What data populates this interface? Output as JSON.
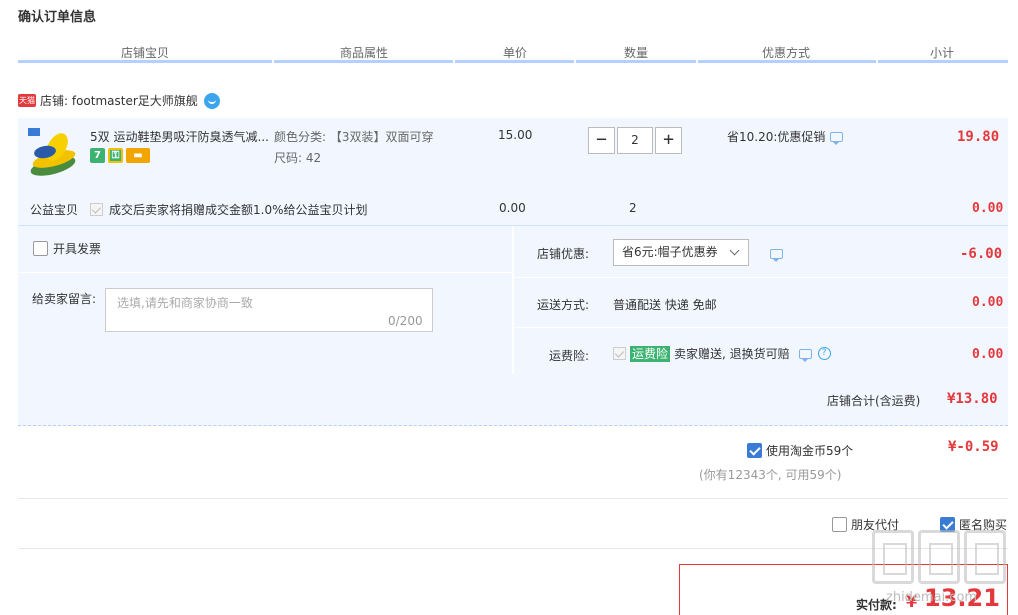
{
  "page_title": "确认订单信息",
  "columns": [
    "店铺宝贝",
    "商品属性",
    "单价",
    "数量",
    "优惠方式",
    "小计"
  ],
  "shop": {
    "badge": "天猫",
    "label": "店铺: footmaster足大师旗舰"
  },
  "item": {
    "title": "5双 运动鞋垫男吸汗防臭透气减...",
    "badge_7": "7",
    "attr_color": "颜色分类: 【3双装】双面可穿",
    "attr_size": "尺码: 42",
    "price": "15.00",
    "quantity": "2",
    "minus": "−",
    "plus": "+",
    "promo": "省10.20:优惠促销",
    "subtotal": "19.80"
  },
  "charity": {
    "label": "公益宝贝",
    "text": "成交后卖家将捐赠成交金额1.0%给公益宝贝计划",
    "price": "0.00",
    "quantity": "2",
    "subtotal": "0.00"
  },
  "invoice_label": "开具发票",
  "message": {
    "label": "给卖家留言:",
    "placeholder": "选填,请先和商家协商一致",
    "count": "0/200"
  },
  "shop_discount": {
    "label": "店铺优惠:",
    "value": "省6元:帽子优惠券",
    "amount": "-6.00"
  },
  "shipping": {
    "label": "运送方式:",
    "value": "普通配送 快递 免邮",
    "amount": "0.00"
  },
  "insurance": {
    "label": "运费险:",
    "badge": "运费险",
    "text": "卖家赠送, 退换货可赔",
    "amount": "0.00"
  },
  "store_total": {
    "label": "店铺合计(含运费)",
    "amount": "¥13.80"
  },
  "taobao_coin": {
    "label": "使用淘金币59个",
    "amount": "¥-0.59",
    "note": "(你有12343个, 可用59个)"
  },
  "options": {
    "friend_pay": "朋友代付",
    "anonymous": "匿名购买"
  },
  "final": {
    "label": "实付款:",
    "currency": "¥",
    "amount": "13.21"
  },
  "watermark_url": "zhidemai.com",
  "colors": {
    "accent_red": "#e4393c",
    "panel_bg": "#f2f7ff",
    "header_line": "#b2d1ff",
    "checkbox_blue": "#3a7bd5"
  }
}
